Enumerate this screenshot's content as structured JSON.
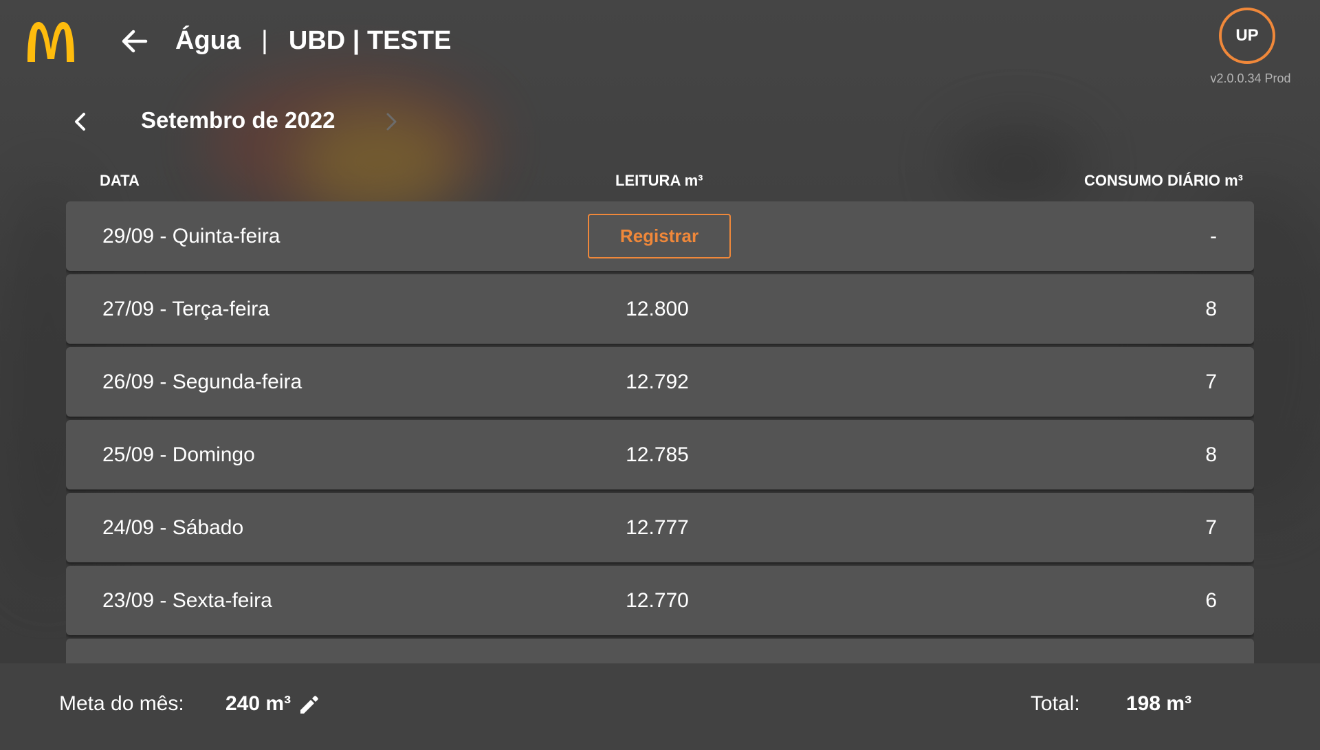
{
  "header": {
    "page_title": "Água",
    "separator": "|",
    "store_name": "UBD | TESTE",
    "user_initials": "UP",
    "version": "v2.0.0.34 Prod"
  },
  "month_nav": {
    "label": "Setembro de 2022"
  },
  "columns": {
    "date": "DATA",
    "reading": "LEITURA m³",
    "daily_consumption": "CONSUMO DIÁRIO m³"
  },
  "rows": [
    {
      "date": "29/09 - Quinta-feira",
      "reading": "",
      "action": "Registrar",
      "consumption": "-"
    },
    {
      "date": "27/09 - Terça-feira",
      "reading": "12.800",
      "consumption": "8"
    },
    {
      "date": "26/09 - Segunda-feira",
      "reading": "12.792",
      "consumption": "7"
    },
    {
      "date": "25/09 - Domingo",
      "reading": "12.785",
      "consumption": "8"
    },
    {
      "date": "24/09 - Sábado",
      "reading": "12.777",
      "consumption": "7"
    },
    {
      "date": "23/09 - Sexta-feira",
      "reading": "12.770",
      "consumption": "6"
    }
  ],
  "footer": {
    "goal_label": "Meta do mês:",
    "goal_value": "240 m³",
    "total_label": "Total:",
    "total_value": "198 m³"
  },
  "colors": {
    "accent": "#f0883a",
    "logo": "#ffbc0d",
    "row_bg": "#545454",
    "footer_bg": "#424242"
  },
  "icons": [
    "mcdonalds-logo",
    "back-arrow-icon",
    "chevron-left-icon",
    "chevron-right-icon",
    "pencil-icon"
  ]
}
